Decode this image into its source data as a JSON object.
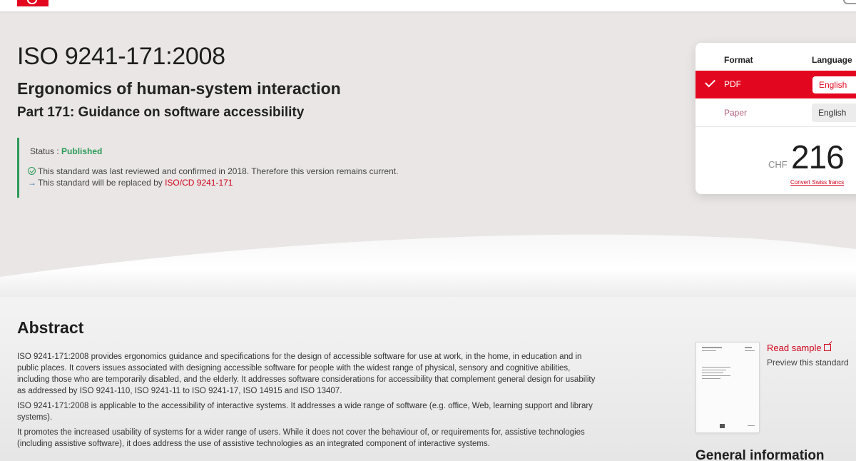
{
  "standard": {
    "code": "ISO 9241-171:2008",
    "title": "Ergonomics of human-system interaction",
    "part": "Part 171: Guidance on software accessibility"
  },
  "status": {
    "label": "Status : ",
    "value": "Published",
    "reviewed_text": "This standard was last reviewed and confirmed in 2018. Therefore this version remains current.",
    "replaced_prefix": "This standard will be replaced by ",
    "replaced_link": "ISO/CD 9241-171",
    "arrow_glyph": "→"
  },
  "purchase": {
    "format_header": "Format",
    "language_header": "Language",
    "options": [
      {
        "format": "PDF",
        "language": "English",
        "selected": true
      },
      {
        "format": "Paper",
        "language": "English",
        "selected": false
      }
    ],
    "currency": "CHF",
    "price": "216",
    "convert_link": "Convert Swiss francs"
  },
  "abstract": {
    "heading": "Abstract",
    "paragraphs": [
      "ISO 9241-171:2008 provides ergonomics guidance and specifications for the design of accessible software for use at work, in the home, in education and in public places. It covers issues associated with designing accessible software for people with the widest range of physical, sensory and cognitive abilities, including those who are temporarily disabled, and the elderly. It addresses software considerations for accessibility that complement general design for usability as addressed by ISO 9241-110, ISO 9241-11 to ISO 9241-17, ISO 14915 and ISO 13407.",
      "ISO 9241-171:2008 is applicable to the accessibility of interactive systems. It addresses a wide range of software (e.g. office, Web, learning support and library systems).",
      "It promotes the increased usability of systems for a wider range of users. While it does not cover the behaviour of, or requirements for, assistive technologies (including assistive software), it does address the use of assistive technologies as an integrated component of interactive systems."
    ]
  },
  "sample": {
    "read_label": "Read sample",
    "preview_label": "Preview this standard"
  },
  "general_info_heading": "General information",
  "colors": {
    "brand_red": "#e3061f",
    "status_green": "#2e9b5a",
    "link_red": "#d0021b"
  }
}
